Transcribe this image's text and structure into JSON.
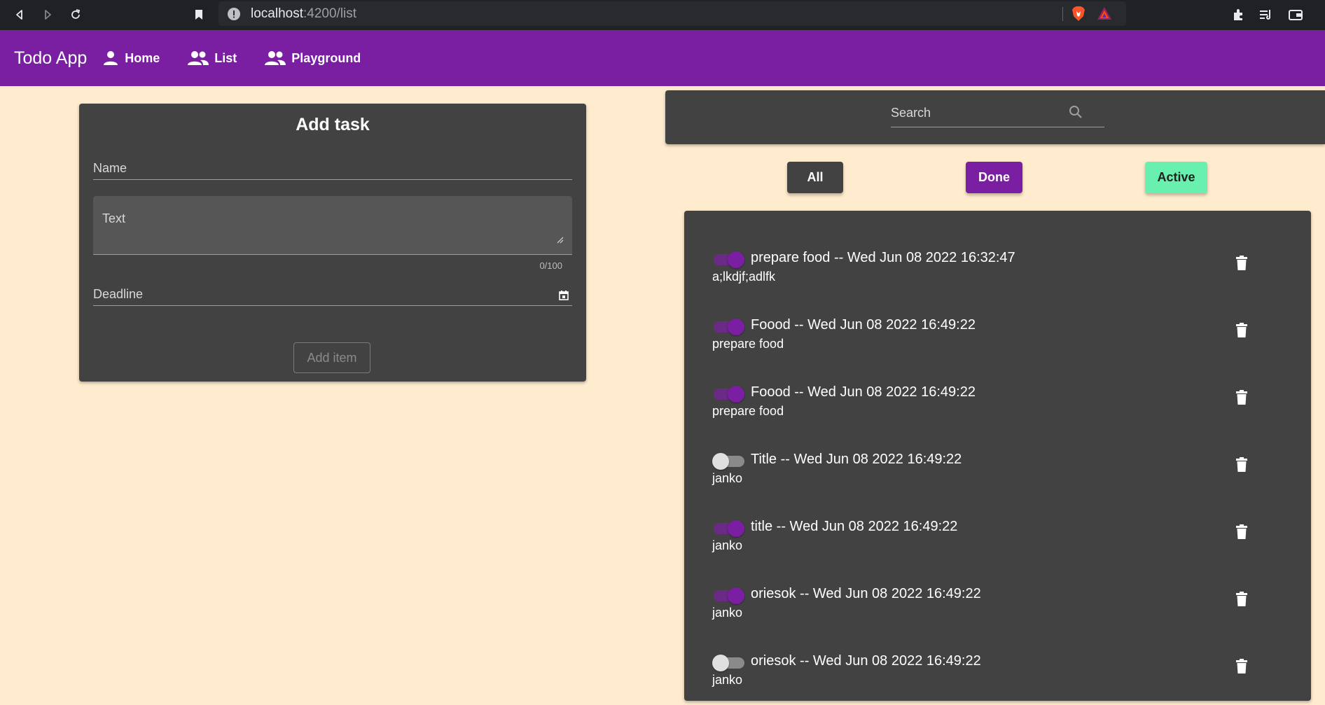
{
  "browser": {
    "url_host": "localhost",
    "url_path": ":4200/list"
  },
  "toolbar": {
    "brand": "Todo App",
    "nav": [
      {
        "label": "Home",
        "icon": "person-icon"
      },
      {
        "label": "List",
        "icon": "people-icon"
      },
      {
        "label": "Playground",
        "icon": "people-icon"
      }
    ]
  },
  "add_task": {
    "title": "Add task",
    "name_label": "Name",
    "text_label": "Text",
    "counter": "0/100",
    "deadline_label": "Deadline",
    "add_button": "Add item"
  },
  "search": {
    "placeholder": "Search"
  },
  "filters": {
    "all": {
      "label": "All",
      "bg": "#424242",
      "color": "#ffffff"
    },
    "done": {
      "label": "Done",
      "bg": "#7b1fa2",
      "color": "#ffffff"
    },
    "active": {
      "label": "Active",
      "bg": "#69f0ae",
      "color": "#212121"
    }
  },
  "colors": {
    "accent": "#7b1fa2",
    "page_bg": "#ffebcd",
    "card_bg": "#424242"
  },
  "tasks": [
    {
      "title": "prepare food -- Wed Jun 08 2022 16:32:47",
      "text": "a;lkdjf;adlfk",
      "done": true
    },
    {
      "title": "Foood -- Wed Jun 08 2022 16:49:22",
      "text": "prepare food",
      "done": true
    },
    {
      "title": "Foood -- Wed Jun 08 2022 16:49:22",
      "text": "prepare food",
      "done": true
    },
    {
      "title": "Title -- Wed Jun 08 2022 16:49:22",
      "text": "janko",
      "done": false
    },
    {
      "title": "title -- Wed Jun 08 2022 16:49:22",
      "text": "janko",
      "done": true
    },
    {
      "title": "oriesok -- Wed Jun 08 2022 16:49:22",
      "text": "janko",
      "done": true
    },
    {
      "title": "oriesok -- Wed Jun 08 2022 16:49:22",
      "text": "janko",
      "done": false
    }
  ]
}
